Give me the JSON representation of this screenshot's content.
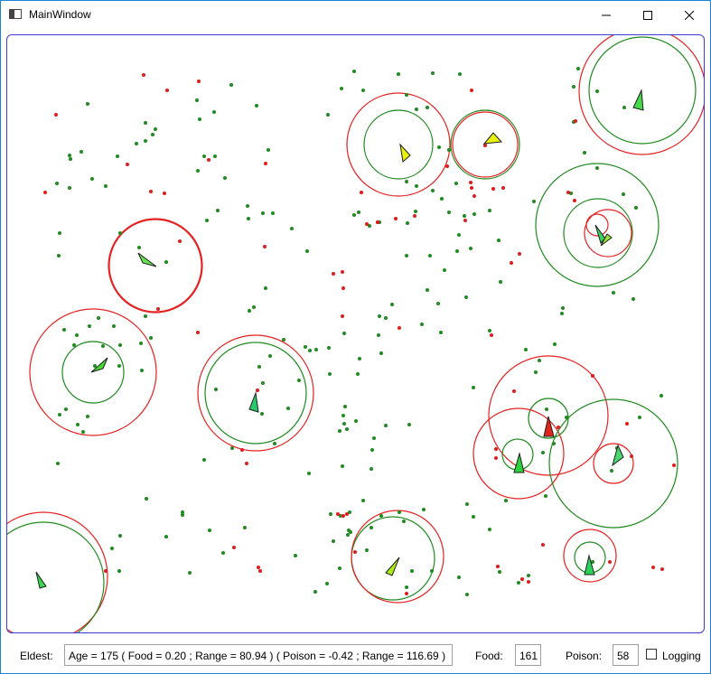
{
  "window": {
    "title": "MainWindow"
  },
  "status": {
    "eldest_label": "Eldest:",
    "eldest_value": "Age = 175  ( Food = 0.20 ; Range = 80.94 )  ( Poison = -0.42 ; Range = 116.69 )",
    "food_label": "Food:",
    "food_value": "161",
    "poison_label": "Poison:",
    "poison_value": "58",
    "logging_label": "Logging",
    "logging_checked": false
  },
  "colors": {
    "food_dot": "#1f8a1f",
    "poison_dot": "#e01b1b",
    "food_ring": "#1f8a1f",
    "poison_ring": "#e52020",
    "canvas_border": "#3b3bd1",
    "title_accent": "#1883d7"
  },
  "icons": {
    "app": "window-app-icon",
    "minimize": "minimize-icon",
    "maximize": "maximize-icon",
    "close": "close-icon"
  }
}
